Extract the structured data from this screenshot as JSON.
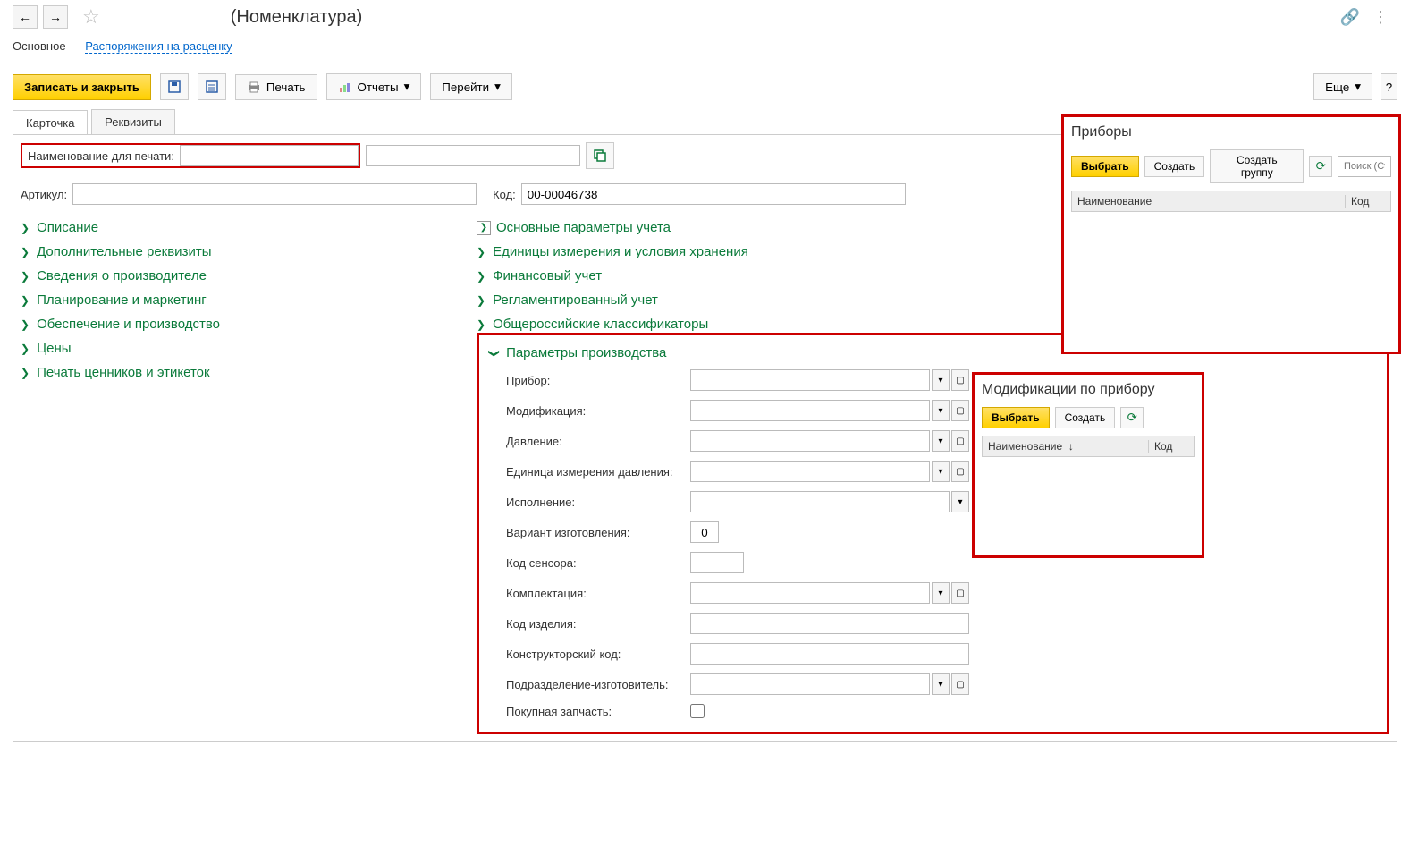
{
  "header": {
    "title": "(Номенклатура)"
  },
  "nav": {
    "main": "Основное",
    "link": "Распоряжения на расценку"
  },
  "actions": {
    "save_close": "Записать и закрыть",
    "print": "Печать",
    "reports": "Отчеты",
    "goto": "Перейти",
    "more": "Еще"
  },
  "tabs": {
    "card": "Карточка",
    "props": "Реквизиты"
  },
  "fields": {
    "print_name_label": "Наименование для печати:",
    "article_label": "Артикул:",
    "code_label": "Код:",
    "code_value": "00-00046738"
  },
  "sections_left": [
    "Описание",
    "Дополнительные реквизиты",
    "Сведения о производителе",
    "Планирование и маркетинг",
    "Обеспечение и производство",
    "Цены",
    "Печать ценников и этикеток"
  ],
  "sections_right": [
    "Основные параметры учета",
    "Единицы измерения и условия хранения",
    "Финансовый учет",
    "Регламентированный учет",
    "Общероссийские классификаторы"
  ],
  "prod_section": {
    "title": "Параметры производства",
    "device": "Прибор:",
    "modification": "Модификация:",
    "pressure": "Давление:",
    "pressure_unit": "Единица измерения давления:",
    "execution": "Исполнение:",
    "variant": "Вариант изготовления:",
    "variant_value": "0",
    "sensor_code": "Код сенсора:",
    "complectation": "Комплектация:",
    "product_code": "Код изделия:",
    "constructor_code": "Конструкторский код:",
    "manufacturer_dept": "Подразделение-изготовитель:",
    "purchased_part": "Покупная запчасть:"
  },
  "popup1": {
    "title": "Приборы",
    "select": "Выбрать",
    "create": "Создать",
    "create_group": "Создать группу",
    "search_placeholder": "Поиск (Ctrl",
    "col_name": "Наименование",
    "col_code": "Код"
  },
  "popup2": {
    "title": "Модификации по прибору",
    "select": "Выбрать",
    "create": "Создать",
    "col_name": "Наименование",
    "col_code": "Код",
    "sort": "↓"
  }
}
